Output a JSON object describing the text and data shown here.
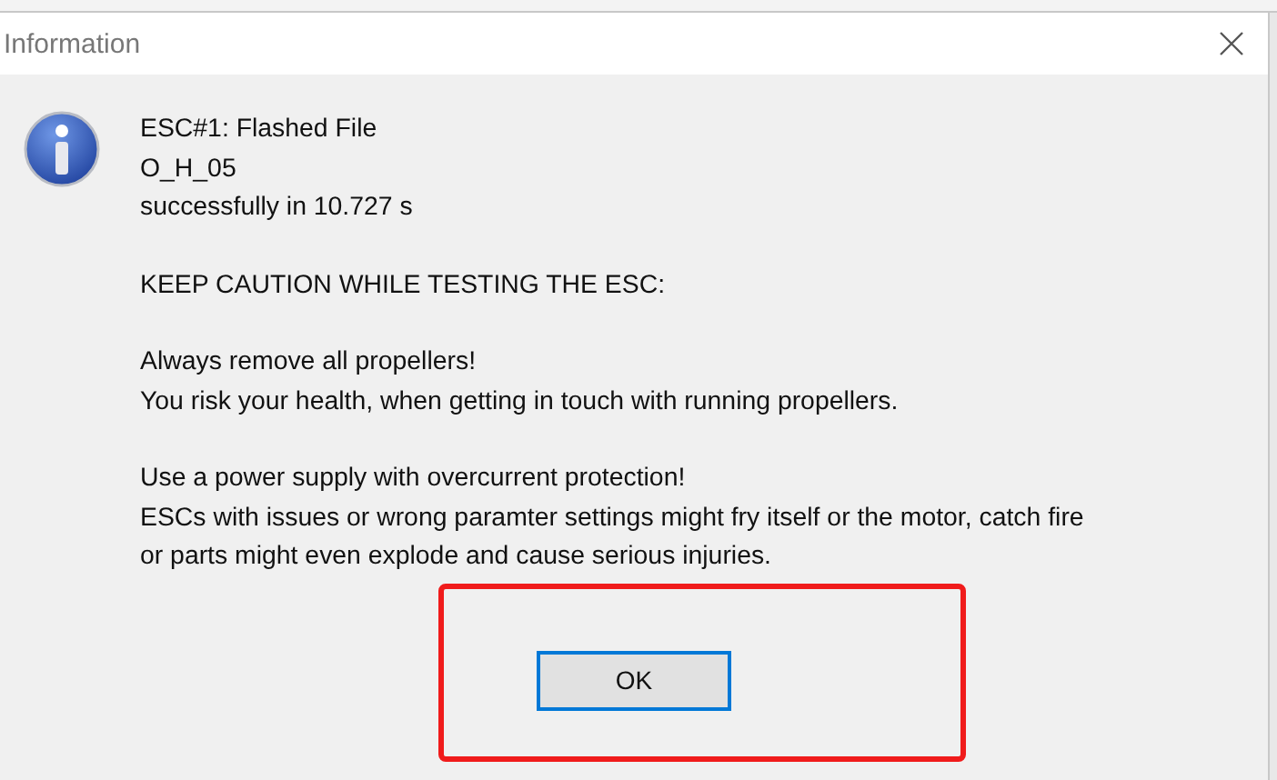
{
  "window": {
    "title": "Information"
  },
  "message": [
    {
      "lines": [
        "ESC#1: Flashed File",
        "O_H_05",
        "successfully in 10.727 s"
      ]
    },
    {
      "lines": [
        "KEEP CAUTION WHILE TESTING THE ESC:"
      ]
    },
    {
      "lines": [
        "Always remove all propellers!",
        "You risk your health, when getting in touch with running propellers."
      ]
    },
    {
      "lines": [
        "Use a power supply with overcurrent protection!",
        "ESCs with issues or wrong paramter settings might fry itself or the motor, catch fire",
        "or parts might even explode and cause serious injuries."
      ]
    }
  ],
  "buttons": [
    {
      "label": "OK",
      "focused": true
    }
  ]
}
